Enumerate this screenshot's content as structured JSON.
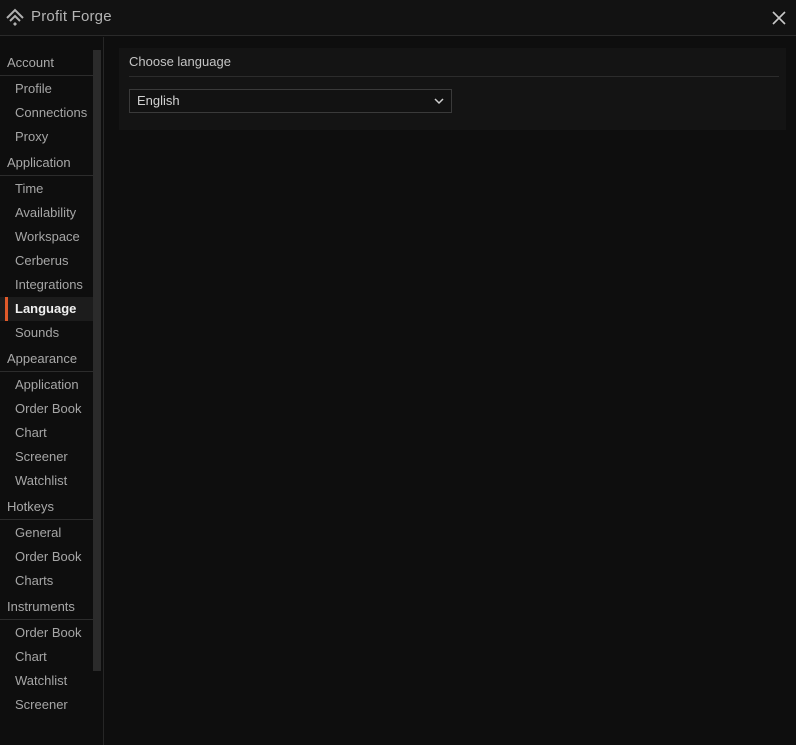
{
  "app": {
    "title": "Profit Forge",
    "logo_icon": "profit-forge-logo-icon",
    "close_icon": "close-icon"
  },
  "colors": {
    "background": "#0e0e0e",
    "panel": "#141414",
    "accent": "#e05a2a",
    "active_item_bg": "#1c1c1c"
  },
  "sidebar": {
    "sections": [
      {
        "title": "Account",
        "items": [
          "Profile",
          "Connections",
          "Proxy"
        ]
      },
      {
        "title": "Application",
        "items": [
          "Time",
          "Availability",
          "Workspace",
          "Cerberus",
          "Integrations",
          "Language",
          "Sounds"
        ]
      },
      {
        "title": "Appearance",
        "items": [
          "Application",
          "Order Book",
          "Chart",
          "Screener",
          "Watchlist"
        ]
      },
      {
        "title": "Hotkeys",
        "items": [
          "General",
          "Order Book",
          "Charts"
        ]
      },
      {
        "title": "Instruments",
        "items": [
          "Order Book",
          "Chart",
          "Watchlist",
          "Screener"
        ]
      }
    ],
    "active_item": "Language"
  },
  "main": {
    "panel_title": "Choose language",
    "language_select": {
      "value": "English",
      "icon": "chevron-down-icon"
    }
  }
}
